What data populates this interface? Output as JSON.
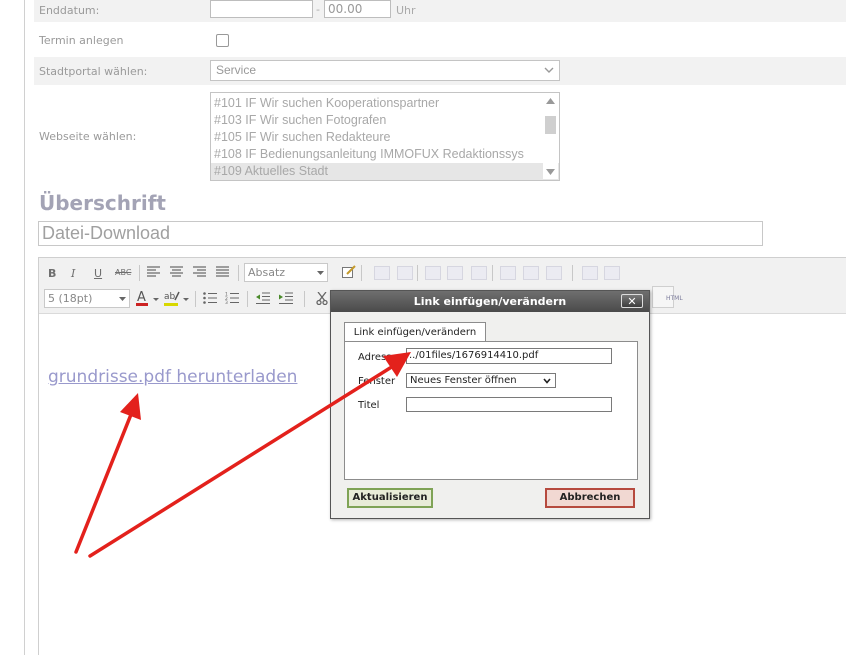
{
  "form": {
    "enddatum_label": "Enddatum:",
    "enddatum_time": "00.00",
    "enddatum_sep": "-",
    "enddatum_unit": "Uhr",
    "termin_label": "Termin anlegen",
    "stadtportal_label": "Stadtportal wählen:",
    "stadtportal_value": "Service",
    "webseite_label": "Webseite wählen:",
    "webseite_options": [
      "#101 IF Wir suchen Kooperationspartner",
      "#103 IF Wir suchen Fotografen",
      "#105 IF Wir suchen Redakteure",
      "#108 IF Bedienungsanleitung IMMOFUX Redaktionssys",
      "#109 Aktuelles Stadt"
    ]
  },
  "heading": "Überschrift",
  "title_value": "Datei-Download",
  "toolbar": {
    "bold": "B",
    "italic": "I",
    "underline": "U",
    "strike": "ABC",
    "format_select": "Absatz",
    "size_select": "5 (18pt)",
    "html": "HTML"
  },
  "editor": {
    "link_text": "grundrisse.pdf herunterladen"
  },
  "dialog": {
    "title": "Link einfügen/verändern",
    "tab": "Link einfügen/verändern",
    "address_label": "Adresse",
    "address_value": "../01files/1676914410.pdf",
    "target_label": "Fenster",
    "target_value": "Neues Fenster öffnen",
    "title_label": "Titel",
    "title_value": "",
    "update_button": "Aktualisieren",
    "cancel_button": "Abbrechen"
  },
  "colors": {
    "arrow": "#e3211c",
    "link": "#9999cc",
    "update_border": "#7fa356",
    "cancel_border": "#b64a3e"
  }
}
